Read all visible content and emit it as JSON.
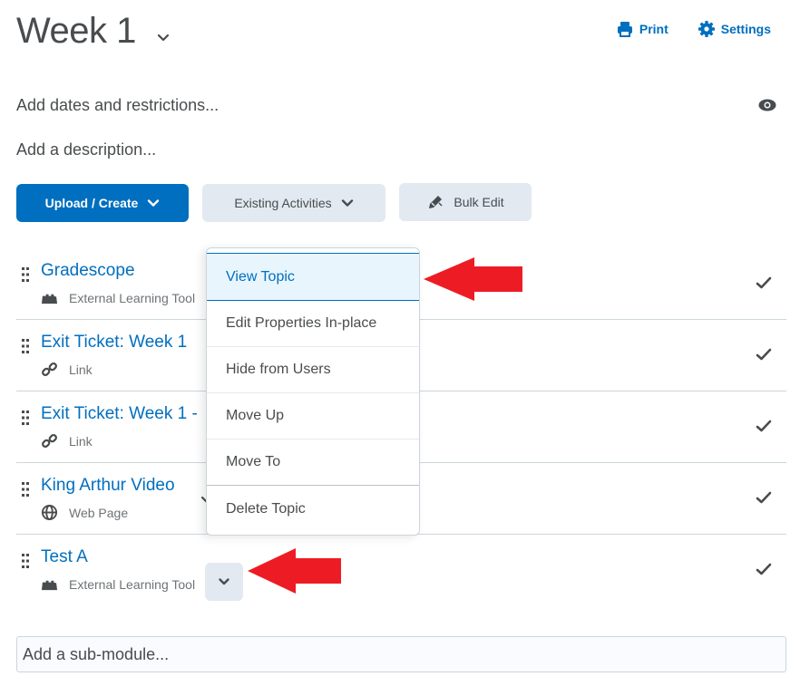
{
  "header": {
    "title": "Week 1",
    "print_label": "Print",
    "settings_label": "Settings"
  },
  "meta": {
    "dates_label": "Add dates and restrictions...",
    "description_label": "Add a description..."
  },
  "toolbar": {
    "upload_create_label": "Upload / Create",
    "existing_activities_label": "Existing Activities",
    "bulk_edit_label": "Bulk Edit"
  },
  "topics": [
    {
      "title": "Gradescope",
      "type": "External Learning Tool",
      "icon": "lego-block-icon"
    },
    {
      "title": "Exit Ticket: Week 1",
      "type": "Link",
      "icon": "link-icon"
    },
    {
      "title": "Exit Ticket: Week 1 -",
      "type": "Link",
      "icon": "link-icon"
    },
    {
      "title": "King Arthur Video",
      "type": "Web Page",
      "icon": "globe-icon"
    },
    {
      "title": "Test A",
      "type": "External Learning Tool",
      "icon": "lego-block-icon"
    }
  ],
  "context_menu": {
    "items": [
      "View Topic",
      "Edit Properties In-place",
      "Hide from Users",
      "Move Up",
      "Move To",
      "Delete Topic"
    ],
    "active_index": 0
  },
  "submodule": {
    "placeholder": "Add a sub-module..."
  },
  "colors": {
    "accent": "#006fbf",
    "annotation_arrow": "#ed1c24"
  }
}
